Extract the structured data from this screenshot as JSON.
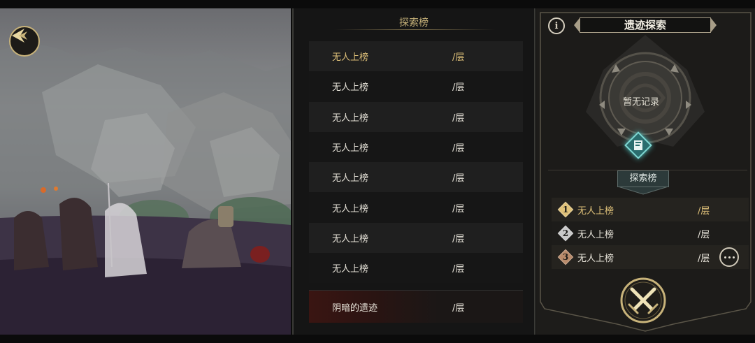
{
  "leaderboard": {
    "title": "探索榜",
    "rows": [
      {
        "name": "无人上榜",
        "floor": "/层"
      },
      {
        "name": "无人上榜",
        "floor": "/层"
      },
      {
        "name": "无人上榜",
        "floor": "/层"
      },
      {
        "name": "无人上榜",
        "floor": "/层"
      },
      {
        "name": "无人上榜",
        "floor": "/层"
      },
      {
        "name": "无人上榜",
        "floor": "/层"
      },
      {
        "name": "无人上榜",
        "floor": "/层"
      },
      {
        "name": "无人上榜",
        "floor": "/层"
      }
    ],
    "self": {
      "name": "阴暗的遗迹",
      "floor": "/层"
    }
  },
  "panel": {
    "info_label": "i",
    "title": "遗迹探索",
    "record_text": "暂无记录",
    "sub_title": "探索榜",
    "top3": [
      {
        "rank": "1",
        "name": "无人上榜",
        "floor": "/层"
      },
      {
        "rank": "2",
        "name": "无人上榜",
        "floor": "/层"
      },
      {
        "rank": "3",
        "name": "无人上榜",
        "floor": "/层"
      }
    ]
  },
  "icons": {
    "back": "back-arrow-icon",
    "info": "info-icon",
    "book": "book-icon",
    "more": "more-icon",
    "battle": "crossed-swords-icon"
  },
  "colors": {
    "gold": "#e0c27a",
    "frame": "#c8b37a",
    "teal": "#4fc3c0",
    "rank1": "#e0c27a",
    "rank2": "#c9c9c9",
    "rank3": "#b88a6a"
  }
}
